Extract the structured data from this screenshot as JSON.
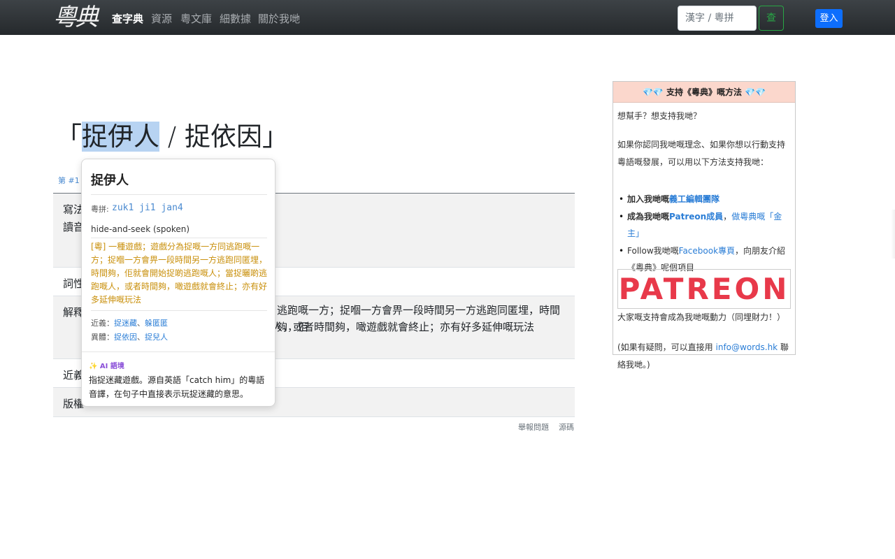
{
  "navbar": {
    "brand": "粵典",
    "links": [
      "查字典",
      "資源",
      "粵文庫",
      "細數據",
      "關於我哋"
    ],
    "search_placeholder": "漢字 / 粵拼",
    "search_button": "查",
    "login_button": "登入"
  },
  "entry": {
    "title_open": "「",
    "title_highlight": "捉伊人",
    "title_rest": " / 捉依因」",
    "entry_label": "第 #1 條",
    "rows": [
      {
        "label": "寫法",
        "label2": "讀音",
        "content": ""
      },
      {
        "label": "詞性",
        "content": ""
      },
      {
        "label": "解釋",
        "content_line1": "逃跑嘅一方；捉嗰一方會畀一段時間另一方逃跑同匿埋，時間夠，佢",
        "content_line2": "人，或者時間夠，噉遊戲就會終止；亦有好多延伸嘅玩法"
      },
      {
        "label": "近義",
        "content": ""
      },
      {
        "label": "版權",
        "content": ""
      }
    ]
  },
  "footer": {
    "report": "舉報問題",
    "source": "源碼"
  },
  "popup": {
    "title": "捉伊人",
    "jyutping_label": "粵拼:",
    "jyutping": "zuk1 ji1 jan4",
    "english": "hide-and-seek (spoken)",
    "definition": "[粵] 一種遊戲；遊戲分為捉嘅一方同逃跑嘅一方；捉嗰一方會畀一段時間另一方逃跑同匿埋，時間夠，佢就會開始捉啲逃跑嘅人；當捉曬啲逃跑嘅人，或者時間夠，噉遊戲就會終止；亦有好多延伸嘅玩法",
    "synonyms_label": "近義：",
    "synonyms": [
      "捉迷藏",
      "躲匿匿"
    ],
    "variants_label": "異體：",
    "variants": [
      "捉依因",
      "捉兒人"
    ],
    "ai_label": "✨ AI 語境",
    "ai_text": "指捉迷藏遊戲。源自英語「catch him」的粵語音譯，在句子中直接表示玩捉迷藏的意思。"
  },
  "sidebar": {
    "header": "💎💎 支持《粵典》嘅方法 💎💎",
    "question": "想幫手？想支持我哋？",
    "intro": "如果你認同我哋嘅理念、如果你想以行動支持粵語嘅發展，可以用以下方法支持我哋：",
    "items": [
      {
        "prefix": "加入我哋嘅",
        "link": "義工編輯團隊",
        "suffix": ""
      },
      {
        "prefix": "成為我哋嘅",
        "link": "Patreon成員",
        "suffix": "，",
        "link2": "做粵典嘅「金主」"
      },
      {
        "prefix": "Follow我哋嘅",
        "link": "Facebook專頁",
        "suffix": "，向朋友介紹《粵典》呢個項目"
      }
    ],
    "patreon_logo": "PATREON",
    "thanks": "大家嘅支持會成為我哋嘅動力（同埋財力！）",
    "contact_prefix": "(如果有疑問，可以直接用 ",
    "contact_email": "info@words.hk",
    "contact_suffix": " 聯絡我哋。)"
  }
}
